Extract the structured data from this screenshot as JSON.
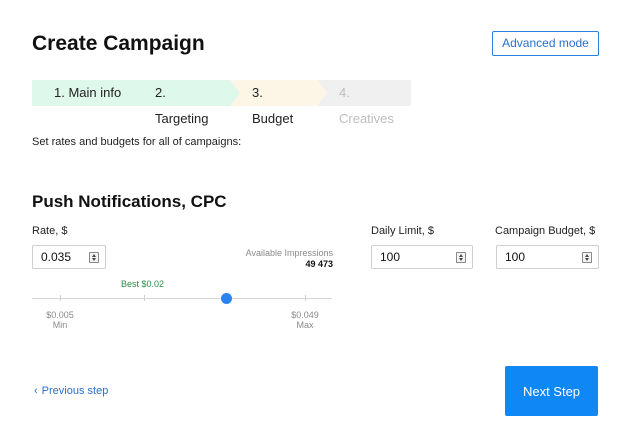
{
  "header": {
    "title": "Create Campaign",
    "advanced_mode_label": "Advanced mode"
  },
  "steps": [
    {
      "label": "1. Main info",
      "state": "done"
    },
    {
      "label": "2. Targeting",
      "state": "done"
    },
    {
      "label": "3. Budget",
      "state": "active"
    },
    {
      "label": "4. Creatives",
      "state": "disabled"
    }
  ],
  "subtitle": "Set rates and budgets for all of campaigns:",
  "section": {
    "title": "Push Notifications, CPC",
    "rate": {
      "label": "Rate, $",
      "value": "0.035"
    },
    "available_impressions": {
      "label": "Available Impressions",
      "value": "49 473"
    },
    "slider": {
      "best_label": "Best $0.02",
      "min_value": "$0.005",
      "min_caption": "Min",
      "max_value": "$0.049",
      "max_caption": "Max",
      "current": 0.035
    },
    "daily_limit": {
      "label": "Daily Limit, $",
      "value": "100"
    },
    "campaign_budget": {
      "label": "Campaign Budget, $",
      "value": "100"
    }
  },
  "footer": {
    "prev_chevron": "‹",
    "prev_label": "Previous step",
    "next_label": "Next Step"
  },
  "colors": {
    "accent": "#0f87f5",
    "step_done": "#dff8ec",
    "step_active": "#fdf6e6",
    "step_disabled": "#f0f0f0",
    "best": "#2e8b46"
  }
}
